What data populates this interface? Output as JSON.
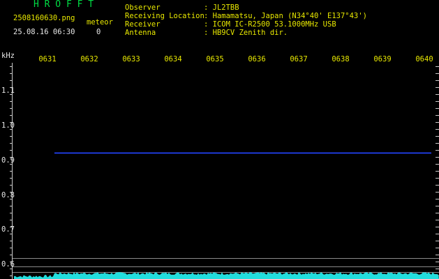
{
  "app": {
    "title": "H R O F F T"
  },
  "file": {
    "name": "2508160630.png",
    "datetime": "25.08.16 06:30"
  },
  "meteor": {
    "label": "meteor",
    "count": "0"
  },
  "info": [
    {
      "key": "Observer",
      "value": ": JL2TBB"
    },
    {
      "key": "Receiving Location",
      "value": ": Hamamatsu, Japan (N34°40' E137°43')"
    },
    {
      "key": "Receiver",
      "value": ": ICOM IC-R2500 53.1000MHz USB"
    },
    {
      "key": "Antenna",
      "value": ": HB9CV Zenith dir."
    }
  ],
  "axis": {
    "y_unit": "kHz",
    "y_ticks": [
      "1.1",
      "1.0",
      "0.9",
      "0.8",
      "0.7",
      "0.6"
    ],
    "x_ticks": [
      "0631",
      "0632",
      "0633",
      "0634",
      "0635",
      "0636",
      "0637",
      "0638",
      "0639",
      "0640"
    ]
  },
  "colors": {
    "title": "#00dd44",
    "label": "#e8e800",
    "text": "#e8e8e8",
    "trace": "#2244ff",
    "signal": "#22dddd"
  }
}
